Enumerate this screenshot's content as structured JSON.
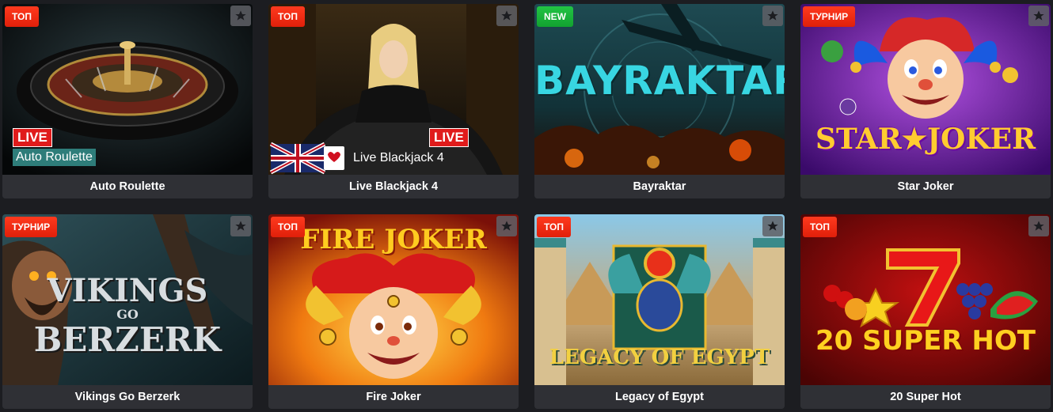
{
  "games": [
    {
      "title": "Auto Roulette",
      "badge": "ТОП",
      "thumb_tag": "LIVE",
      "thumb_label": "Auto Roulette"
    },
    {
      "title": "Live Blackjack 4",
      "badge": "ТОП",
      "thumb_tag": "LIVE",
      "thumb_label": "Live Blackjack 4"
    },
    {
      "title": "Bayraktar",
      "badge": "NEW",
      "thumb_logo": "BAYRAKTAR"
    },
    {
      "title": "Star Joker",
      "badge": "ТУРНИР",
      "thumb_logo": "STAR★JOKER"
    },
    {
      "title": "Vikings Go Berzerk",
      "badge": "ТУРНИР",
      "thumb_logo_1": "VIKINGS",
      "thumb_logo_2": "GO",
      "thumb_logo_3": "BERZERK"
    },
    {
      "title": "Fire Joker",
      "badge": "ТОП",
      "thumb_logo": "FIRE JOKER"
    },
    {
      "title": "Legacy of Egypt",
      "badge": "ТОП",
      "thumb_logo": "LEGACY OF EGYPT"
    },
    {
      "title": "20 Super Hot",
      "badge": "ТОП",
      "thumb_logo": "20 SUPER HOT"
    }
  ],
  "colors": {
    "background": "#1c1d21",
    "card_caption": "#2f3035",
    "badge_red": "#e0200a",
    "badge_green": "#12a130",
    "live_red": "#e01b1b"
  },
  "icons": {
    "favorite": "star-icon"
  }
}
